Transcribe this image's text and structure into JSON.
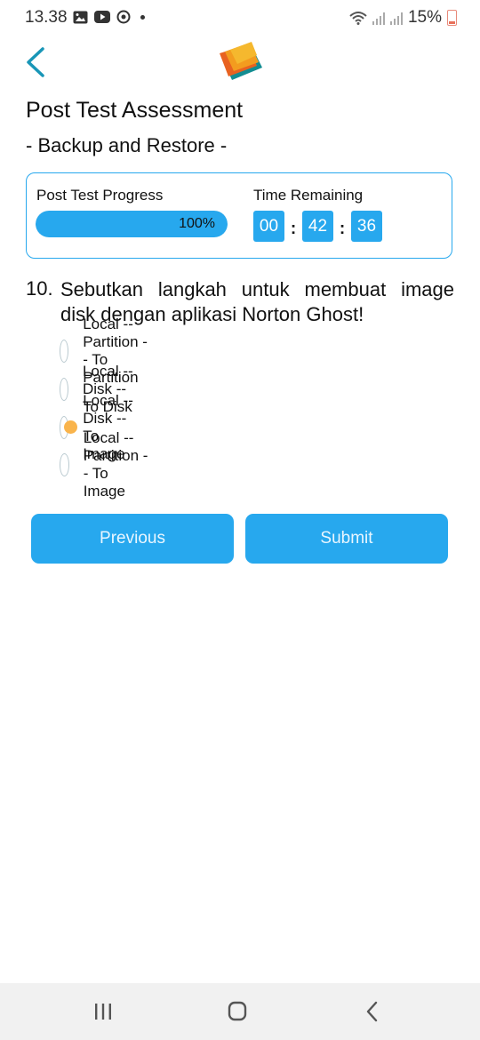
{
  "status_bar": {
    "time": "13.38",
    "battery": "15%",
    "icons": [
      "image-icon",
      "youtube-icon",
      "sync-icon",
      "dot-icon",
      "wifi-icon",
      "signal-icon",
      "signal-icon",
      "battery-icon"
    ]
  },
  "header": {
    "title": "Post Test Assessment",
    "subtitle": "- Backup and Restore -",
    "back_icon": "chevron-left-icon",
    "logo_icon": "books-logo-icon"
  },
  "progress_card": {
    "progress_label": "Post Test Progress",
    "progress_value": 1.0,
    "progress_text": "100%",
    "time_label": "Time Remaining",
    "hours": "00",
    "minutes": "42",
    "seconds": "36",
    "separator": ":"
  },
  "question": {
    "number": "10.",
    "text": "Sebutkan langkah untuk membuat image disk dengan aplikasi Norton Ghost!",
    "options": [
      {
        "label": "Local -- Partition -- To Partition",
        "selected": false
      },
      {
        "label": "Local -- Disk -- To Disk",
        "selected": false
      },
      {
        "label": "Local -- Disk -- To Image",
        "selected": true
      },
      {
        "label": "Local -- Partition -- To Image",
        "selected": false
      }
    ]
  },
  "buttons": {
    "previous": "Previous",
    "submit": "Submit"
  },
  "colors": {
    "accent": "#27a8ee",
    "selected_radio": "#f9b44c"
  },
  "nav_bar": {
    "icons": [
      "recent-apps-icon",
      "home-icon",
      "back-icon"
    ]
  }
}
